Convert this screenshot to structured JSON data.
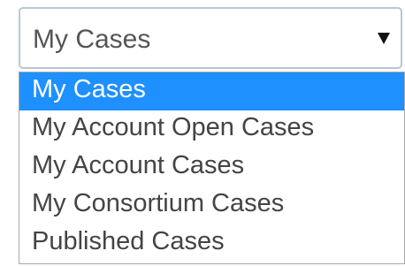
{
  "select": {
    "value": "My Cases",
    "arrow_icon": "triangle-down-icon",
    "options": [
      {
        "label": "My Cases",
        "selected": true
      },
      {
        "label": "My Account Open Cases",
        "selected": false
      },
      {
        "label": "My Account Cases",
        "selected": false
      },
      {
        "label": "My Consortium Cases",
        "selected": false
      },
      {
        "label": "Published Cases",
        "selected": false
      }
    ]
  },
  "colors": {
    "highlight": "#1e90ff",
    "text": "#444444",
    "border": "#b9c6d6"
  }
}
